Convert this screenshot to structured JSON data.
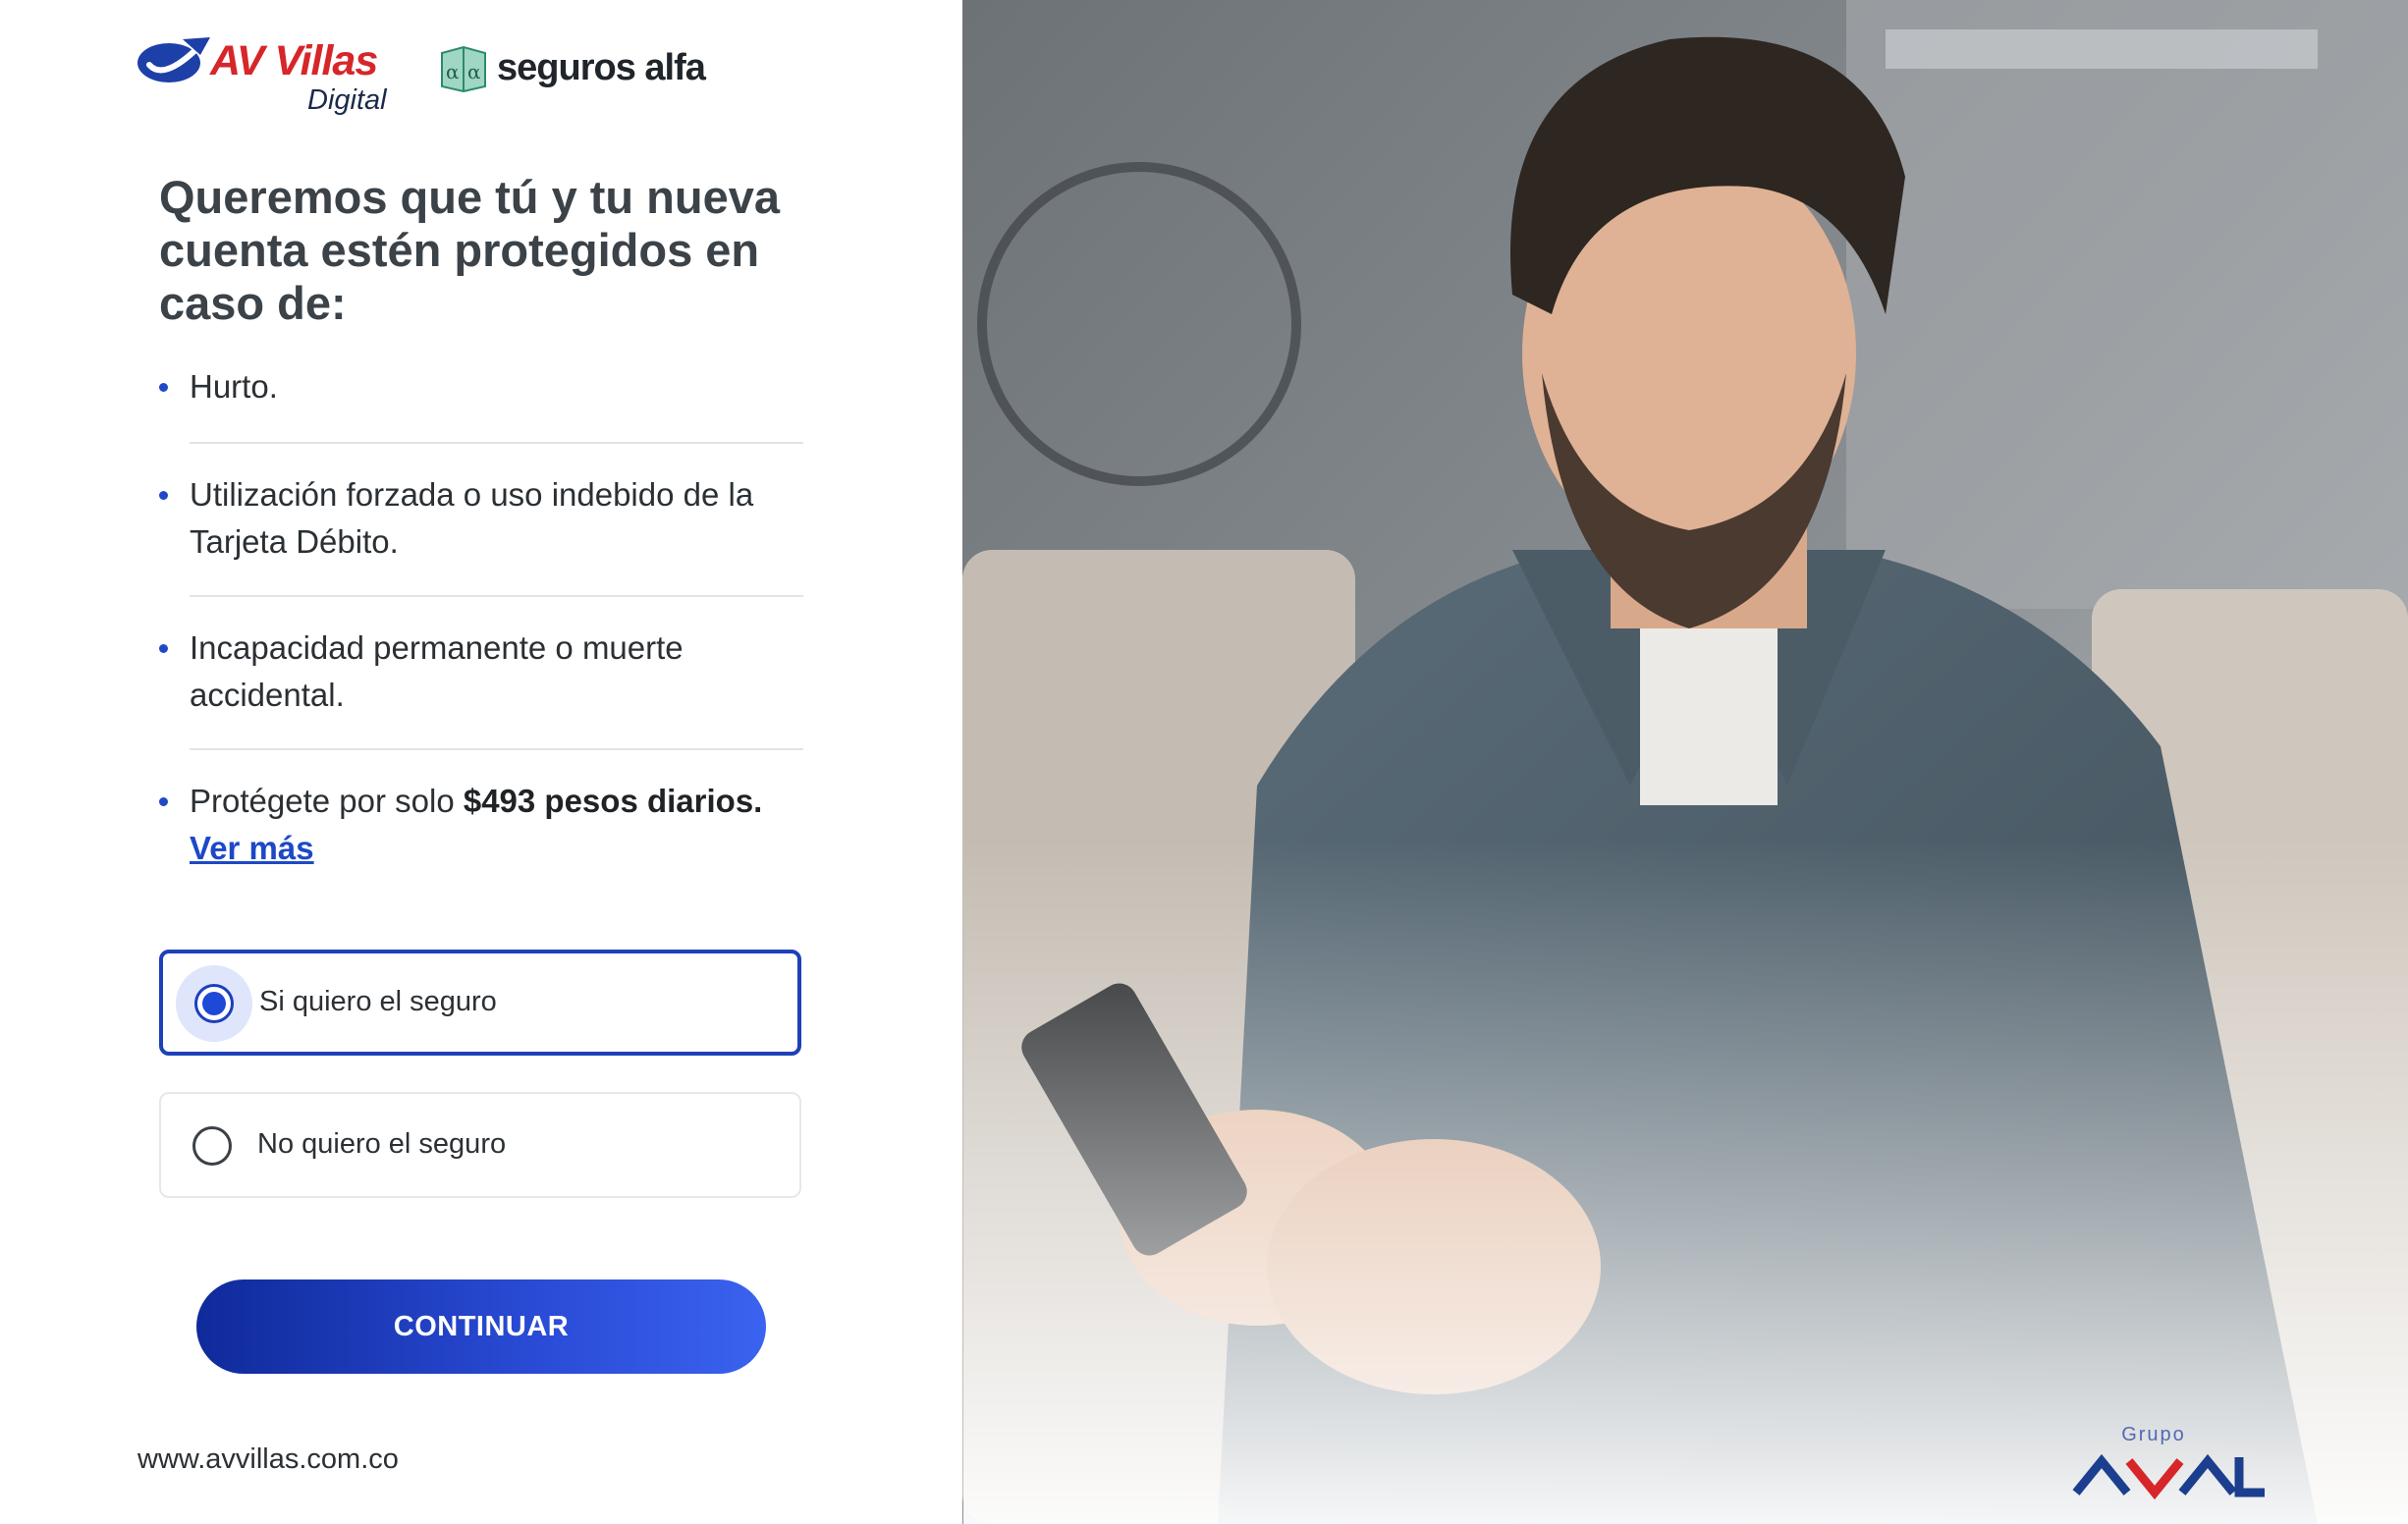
{
  "brand": {
    "primary_name": "AV Villas",
    "primary_sub": "Digital",
    "partner_name": "seguros alfa",
    "group_label": "Grupo",
    "group_name": "AVAL"
  },
  "colors": {
    "brand_red": "#d7262a",
    "accent_blue": "#1d48c8",
    "button_gradient_start": "#0f2a9a",
    "button_gradient_end": "#3a63ef"
  },
  "main": {
    "headline": "Queremos que tú y tu nueva cuenta estén protegidos en caso de:",
    "benefits": [
      {
        "text": "Hurto."
      },
      {
        "text": "Utilización forzada o uso indebido de la Tarjeta Débito."
      },
      {
        "text": "Incapacidad permanente o muerte accidental."
      },
      {
        "text_before": "Protégete por solo ",
        "text_strong": "$493 pesos diarios.",
        "link": "Ver más"
      }
    ],
    "options": [
      {
        "label": "Si quiero el seguro",
        "selected": true
      },
      {
        "label": "No quiero el seguro",
        "selected": false
      }
    ],
    "continue_label": "CONTINUAR"
  },
  "footer": {
    "site": "www.avvillas.com.co"
  }
}
